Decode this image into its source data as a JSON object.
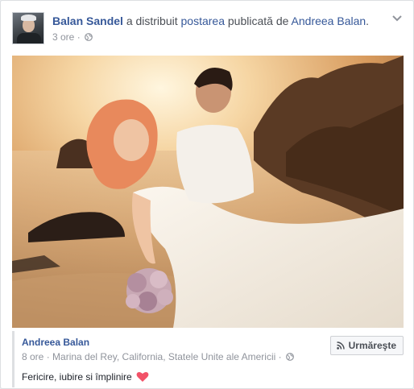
{
  "post": {
    "sharer": "Balan Sandel",
    "action_text": "a distribuit",
    "post_link": "postarea",
    "middle_text": "publicată de",
    "original_author": "Andreea Balan",
    "end_punct": ".",
    "time": "3 ore",
    "separator": "·",
    "privacy_icon": "globe-icon",
    "menu_icon": "chevron-down-icon"
  },
  "shared": {
    "author": "Andreea Balan",
    "time": "8 ore",
    "separator": "·",
    "location": "Marina del Rey, California, Statele Unite ale Americii",
    "privacy_icon": "globe-icon",
    "follow_label": "Urmăreşte",
    "follow_icon": "rss-icon",
    "caption": "Fericire, iubire si împlinire",
    "caption_emoji": "heart-icon"
  },
  "colors": {
    "link": "#365899",
    "meta": "#90949c",
    "heart": "#f25268"
  }
}
